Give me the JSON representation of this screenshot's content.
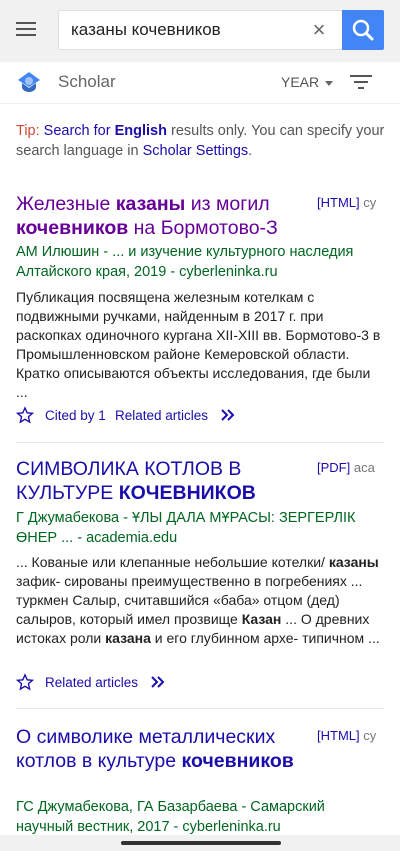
{
  "search": {
    "query": "казаны кочевников",
    "clear_glyph": "×"
  },
  "nav": {
    "brand": "Scholar",
    "year_filter": "YEAR"
  },
  "tip": {
    "label": "Tip:",
    "text1": "Search for",
    "english": "English",
    "text2": "results only. You can specify your search language in",
    "settings": "Scholar Settings",
    "text3": "."
  },
  "results": [
    {
      "title_parts": [
        "Железные ",
        "казаны",
        " из могил ",
        "кочевников",
        " на Бормотово-З"
      ],
      "tag": "[HTML]",
      "tag_source": "cy",
      "authors": "АМ Илюшин - ... и изучение культурного наследия Алтайского края, 2019 - cyberleninka.ru",
      "snippet": "Публикация посвящена железным котелкам с подвижными ручками, найденным в 2017 г. при раскопках одиночного кургана XII-XIII вв. Бормотово-3 в Промышленновском районе Кемеровской области. Кратко описываются объекты исследования, где были ...",
      "cited_by": "Cited by 1",
      "related": "Related articles"
    },
    {
      "title_parts": [
        "СИМВОЛИКА КОТЛОВ В КУЛЬТУРЕ ",
        "КОЧЕВНИКОВ"
      ],
      "tag": "[PDF]",
      "tag_source": "aca",
      "authors": "Г Джумабекова - ҰЛЫ ДАЛА МҰРАСЫ: ЗЕРГЕРЛІК ӨНЕР ... - academia.edu",
      "snippet_parts": [
        "... Кованые или клепанные небольшие котелки/ ",
        "казаны",
        " зафик- сированы преимущественно в погребениях ... туркмен Салыр, считавшийся «баба» отцом (дед) салыров, который имел прозвище ",
        "Казан",
        " ... О древних истоках роли ",
        "казана",
        " и его глубинном архе- типичном ..."
      ],
      "related": "Related articles"
    },
    {
      "title_parts": [
        "О символике металлических котлов в культуре ",
        "кочевников"
      ],
      "tag": "[HTML]",
      "tag_source": "cy",
      "authors": "ГС Джумабекова, ГА Базарбаева - Самарский научный вестник, 2017 - cyberleninka.ru"
    }
  ],
  "colors": {
    "link": "#1a0dab",
    "visited": "#660099",
    "green": "#006621",
    "accent": "#4285f4",
    "tip_red": "#d14836"
  }
}
